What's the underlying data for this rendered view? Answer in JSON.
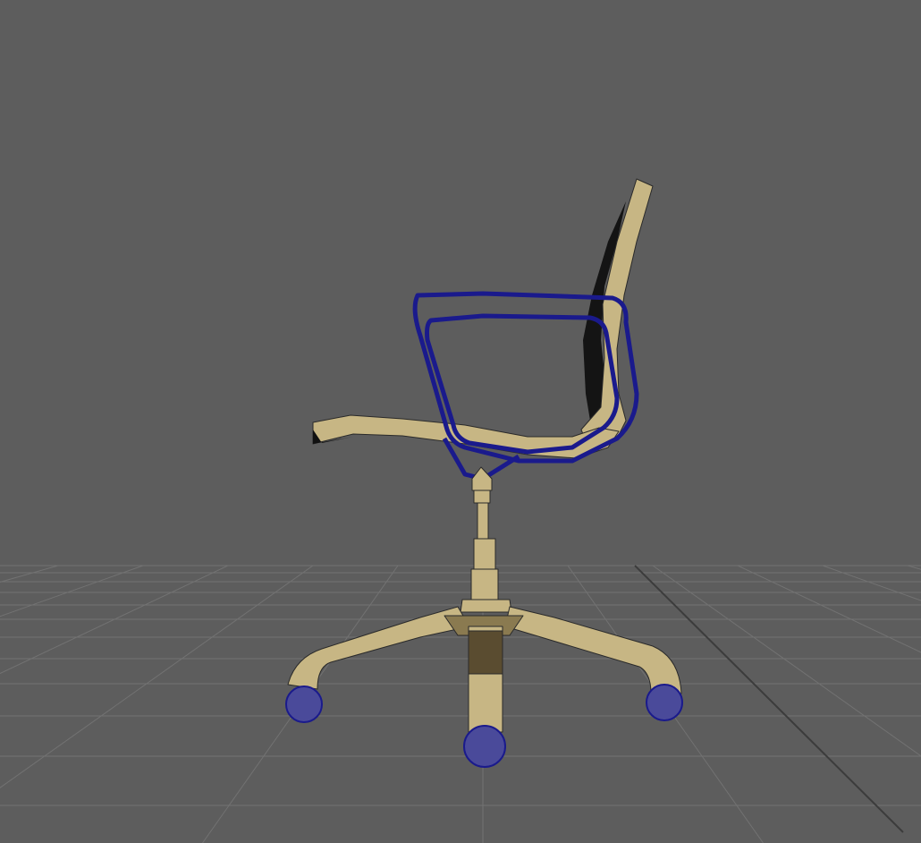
{
  "viewport": {
    "background": "#5d5d5d",
    "grid_color": "#727272",
    "grid_axis_color": "#3c3c3c",
    "model_fill": "#c7b684",
    "model_shadow": "#5a4c30",
    "wireframe_color": "#1a1a8c",
    "edge_color": "#2a2a2a"
  }
}
